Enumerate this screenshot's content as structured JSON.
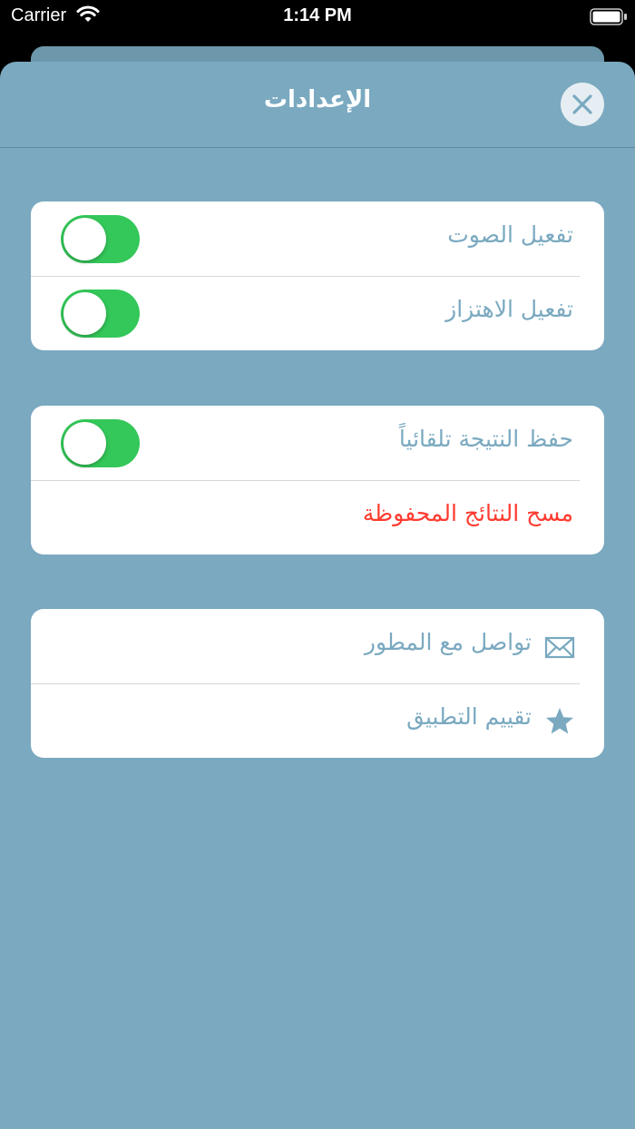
{
  "status_bar": {
    "carrier": "Carrier",
    "time": "1:14 PM"
  },
  "nav": {
    "title": "الإعدادات",
    "close_icon": "close-icon"
  },
  "groups": {
    "feedback": {
      "sound_label": "تفعيل الصوت",
      "sound_on": true,
      "vibration_label": "تفعيل الاهتزاز",
      "vibration_on": true
    },
    "results": {
      "autosave_label": "حفظ النتيجة تلقائياً",
      "autosave_on": true,
      "clear_label": "مسح النتائج المحفوظة"
    },
    "about": {
      "contact_label": "تواصل مع المطور",
      "contact_icon": "envelope-icon",
      "rate_label": "تقييم التطبيق",
      "rate_icon": "star-icon"
    }
  },
  "colors": {
    "background": "#7aa9c0",
    "toggle_on": "#34c759",
    "danger": "#ff3b30",
    "label": "#7aa9c0"
  }
}
